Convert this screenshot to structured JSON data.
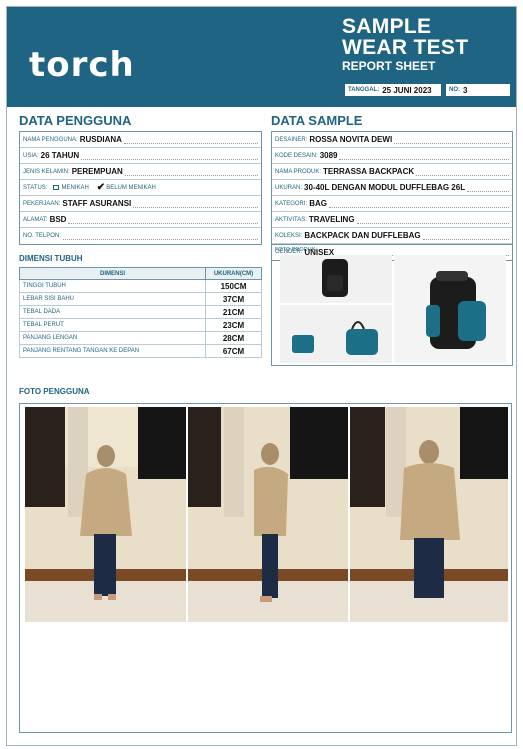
{
  "header": {
    "logo": "torch",
    "title_line1": "SAMPLE",
    "title_line2": "WEAR TEST",
    "title_line3": "REPORT SHEET",
    "date_label": "TANGGAL:",
    "date_value": "25 JUNI 2023",
    "no_label": "NO:",
    "no_value": "3"
  },
  "user": {
    "title": "DATA PENGGUNA",
    "fields": [
      {
        "label": "NAMA PENGGUNA:",
        "value": "RUSDIANA"
      },
      {
        "label": "USIA:",
        "value": "26 TAHUN"
      },
      {
        "label": "JENIS KELAMIN:",
        "value": "PEREMPUAN"
      },
      {
        "label": "STATUS:",
        "value": ""
      },
      {
        "label": "PEKERJAAN:",
        "value": "STAFF ASURANSI"
      },
      {
        "label": "ALAMAT:",
        "value": "BSD"
      },
      {
        "label": "NO. TELPON:",
        "value": ""
      }
    ],
    "status_opt1": "MENIKAH",
    "status_opt2": "BELUM MENIKAH"
  },
  "dimensions": {
    "title": "DIMENSI TUBUH",
    "col_dim": "DIMENSI",
    "col_size": "UKURAN(CM)",
    "rows": [
      {
        "label": "TINGGI TUBUH",
        "value": "150CM"
      },
      {
        "label": "LEBAR SISI BAHU",
        "value": "37CM"
      },
      {
        "label": "TEBAL DADA",
        "value": "21CM"
      },
      {
        "label": "TEBAL PERUT",
        "value": "23CM"
      },
      {
        "label": "PANJANG LENGAN",
        "value": "28CM"
      },
      {
        "label": "PANJANG RENTANG TANGAN KE DEPAN",
        "value": "67CM"
      }
    ]
  },
  "sample": {
    "title": "DATA SAMPLE",
    "fields": [
      {
        "label": "DESAINER:",
        "value": "ROSSA NOVITA DEWI"
      },
      {
        "label": "KODE DESAIN:",
        "value": "3089"
      },
      {
        "label": "NAMA PRODUK:",
        "value": "TERRASSA BACKPACK"
      },
      {
        "label": "UKURAN:",
        "value": "30-40L DENGAN MODUL DUFFLEBAG 26L"
      },
      {
        "label": "KATEGORI:",
        "value": "BAG"
      },
      {
        "label": "AKTIVITAS:",
        "value": "TRAVELING"
      },
      {
        "label": "KOLEKSI:",
        "value": "BACKPACK DAN DUFFLEBAG"
      },
      {
        "label": "GENDER:",
        "value": "UNISEX"
      }
    ],
    "produk_label": "FOTO PRODUK:"
  },
  "photos": {
    "title": "FOTO PENGGUNA"
  },
  "colors": {
    "brand": "#1f6482",
    "bag_teal": "#1b6f86",
    "bag_black": "#1c1c1c"
  }
}
